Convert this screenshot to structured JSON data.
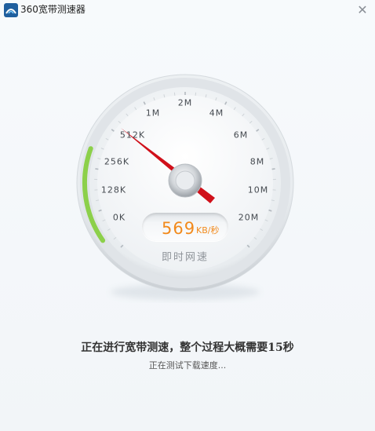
{
  "window": {
    "title": "360宽带测速器",
    "close_symbol": "✕",
    "app_icon": "360-broadband-icon"
  },
  "gauge": {
    "tick_labels": [
      "0K",
      "128K",
      "256K",
      "512K",
      "1M",
      "2M",
      "4M",
      "6M",
      "8M",
      "10M",
      "20M"
    ],
    "speed_value": "569",
    "speed_unit": "KB/秒",
    "caption": "即时网速",
    "progress_color": "#8cd04a",
    "needle_color": "#d0101a",
    "value_color": "#f28a1c"
  },
  "status": {
    "title": "正在进行宽带测速，整个过程大概需要15秒",
    "subtitle": "正在测试下载速度..."
  }
}
